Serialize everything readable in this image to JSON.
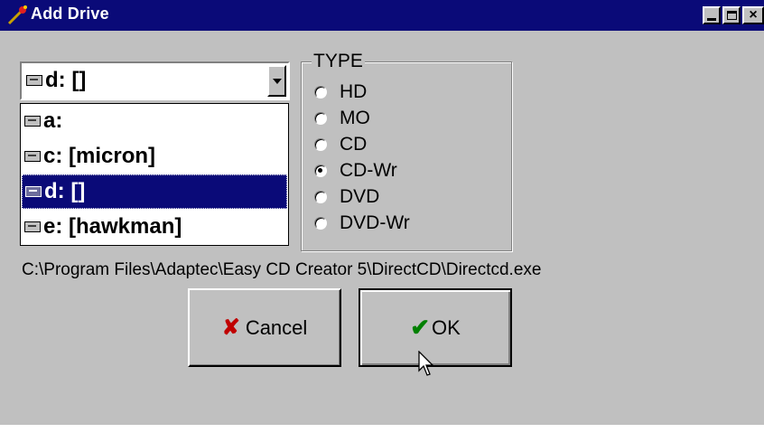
{
  "window": {
    "title": "Add Drive",
    "controls": {
      "minimize": "minimize-button",
      "maximize": "maximize-button",
      "close": "×"
    }
  },
  "drive_combo": {
    "selected_value": "d: []"
  },
  "drive_list": {
    "items": [
      {
        "label": "a:",
        "selected": false
      },
      {
        "label": "c: [micron]",
        "selected": false
      },
      {
        "label": "d: []",
        "selected": true
      },
      {
        "label": "e: [hawkman]",
        "selected": false
      }
    ]
  },
  "type_group": {
    "label": "TYPE",
    "options": [
      {
        "label": "HD",
        "checked": false
      },
      {
        "label": "MO",
        "checked": false
      },
      {
        "label": "CD",
        "checked": false
      },
      {
        "label": "CD-Wr",
        "checked": true
      },
      {
        "label": "DVD",
        "checked": false
      },
      {
        "label": "DVD-Wr",
        "checked": false
      }
    ]
  },
  "path": "C:\\Program Files\\Adaptec\\Easy CD Creator 5\\DirectCD\\Directcd.exe",
  "buttons": {
    "cancel_label": "Cancel",
    "ok_label": "OK"
  },
  "colors": {
    "title_bar": "#0a0a78",
    "face": "#c0c0c0",
    "selection": "#0a0a78",
    "cancel_icon": "#c00000",
    "ok_icon": "#008000"
  }
}
